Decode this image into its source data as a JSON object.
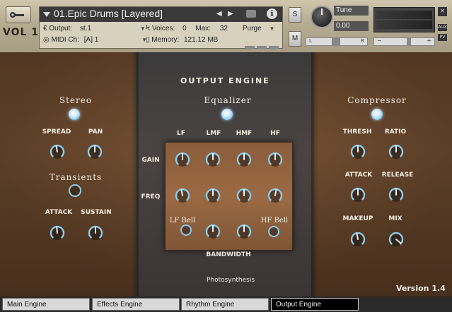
{
  "header": {
    "logo": "VOL 1",
    "instrument_name": "01.Epic Drums [Layered]",
    "output_label": "Output:",
    "output_value": "st.1",
    "voices_label": "Voices:",
    "voices_value": "0",
    "max_label": "Max:",
    "max_value": "32",
    "midi_label": "MIDI Ch:",
    "midi_value": "[A]  1",
    "memory_label": "Memory:",
    "memory_value": "121.12 MB",
    "purge_label": "Purge",
    "solo_label": "S",
    "mute_label": "M",
    "tune_label": "Tune",
    "tune_value": "0.00",
    "pan_left": "L",
    "pan_right": "R",
    "close_label": "×",
    "aux_label": "AUX",
    "pv_label": "PV",
    "vol_minus": "−",
    "vol_plus": "+"
  },
  "main": {
    "title": "OUTPUT ENGINE",
    "stereo": {
      "title": "Stereo",
      "spread": "SPREAD",
      "pan": "PAN"
    },
    "transients": {
      "title": "Transients",
      "attack": "ATTACK",
      "sustain": "SUSTAIN"
    },
    "equalizer": {
      "title": "Equalizer",
      "lf": "LF",
      "lmf": "LMF",
      "hmf": "HMF",
      "hf": "HF",
      "gain": "GAIN",
      "freq": "FREQ",
      "lf_bell": "LF Bell",
      "hf_bell": "HF Bell",
      "bandwidth": "BANDWIDTH"
    },
    "compressor": {
      "title": "Compressor",
      "thresh": "THRESH",
      "ratio": "RATIO",
      "attack": "ATTACK",
      "release": "RELEASE",
      "makeup": "MAKEUP",
      "mix": "MIX"
    },
    "credit": "Photosynthesis",
    "version": "Version 1.4"
  },
  "tabs": [
    "Main Engine",
    "Effects Engine",
    "Rhythm Engine",
    "Output Engine"
  ],
  "colors": {
    "accent": "#8ecbe8",
    "wood": "#6e4a2e",
    "panel": "#3b3b3b"
  }
}
